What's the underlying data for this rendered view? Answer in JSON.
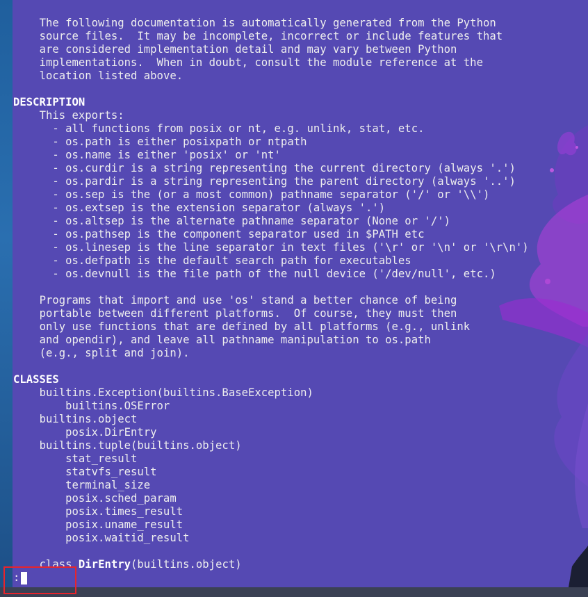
{
  "terminal": {
    "lines": [
      {
        "indent": "    ",
        "text": "The following documentation is automatically generated from the Python",
        "bold": false
      },
      {
        "indent": "    ",
        "text": "source files.  It may be incomplete, incorrect or include features that",
        "bold": false
      },
      {
        "indent": "    ",
        "text": "are considered implementation detail and may vary between Python",
        "bold": false
      },
      {
        "indent": "    ",
        "text": "implementations.  When in doubt, consult the module reference at the",
        "bold": false
      },
      {
        "indent": "    ",
        "text": "location listed above.",
        "bold": false
      },
      {
        "indent": "",
        "text": "",
        "bold": false
      },
      {
        "indent": "",
        "text": "DESCRIPTION",
        "bold": true
      },
      {
        "indent": "    ",
        "text": "This exports:",
        "bold": false
      },
      {
        "indent": "      ",
        "text": "- all functions from posix or nt, e.g. unlink, stat, etc.",
        "bold": false
      },
      {
        "indent": "      ",
        "text": "- os.path is either posixpath or ntpath",
        "bold": false
      },
      {
        "indent": "      ",
        "text": "- os.name is either 'posix' or 'nt'",
        "bold": false
      },
      {
        "indent": "      ",
        "text": "- os.curdir is a string representing the current directory (always '.')",
        "bold": false
      },
      {
        "indent": "      ",
        "text": "- os.pardir is a string representing the parent directory (always '..')",
        "bold": false
      },
      {
        "indent": "      ",
        "text": "- os.sep is the (or a most common) pathname separator ('/' or '\\\\')",
        "bold": false
      },
      {
        "indent": "      ",
        "text": "- os.extsep is the extension separator (always '.')",
        "bold": false
      },
      {
        "indent": "      ",
        "text": "- os.altsep is the alternate pathname separator (None or '/')",
        "bold": false
      },
      {
        "indent": "      ",
        "text": "- os.pathsep is the component separator used in $PATH etc",
        "bold": false
      },
      {
        "indent": "      ",
        "text": "- os.linesep is the line separator in text files ('\\r' or '\\n' or '\\r\\n')",
        "bold": false
      },
      {
        "indent": "      ",
        "text": "- os.defpath is the default search path for executables",
        "bold": false
      },
      {
        "indent": "      ",
        "text": "- os.devnull is the file path of the null device ('/dev/null', etc.)",
        "bold": false
      },
      {
        "indent": "",
        "text": "",
        "bold": false
      },
      {
        "indent": "    ",
        "text": "Programs that import and use 'os' stand a better chance of being",
        "bold": false
      },
      {
        "indent": "    ",
        "text": "portable between different platforms.  Of course, they must then",
        "bold": false
      },
      {
        "indent": "    ",
        "text": "only use functions that are defined by all platforms (e.g., unlink",
        "bold": false
      },
      {
        "indent": "    ",
        "text": "and opendir), and leave all pathname manipulation to os.path",
        "bold": false
      },
      {
        "indent": "    ",
        "text": "(e.g., split and join).",
        "bold": false
      },
      {
        "indent": "",
        "text": "",
        "bold": false
      },
      {
        "indent": "",
        "text": "CLASSES",
        "bold": true
      },
      {
        "indent": "    ",
        "text": "builtins.Exception(builtins.BaseException)",
        "bold": false
      },
      {
        "indent": "        ",
        "text": "builtins.OSError",
        "bold": false
      },
      {
        "indent": "    ",
        "text": "builtins.object",
        "bold": false
      },
      {
        "indent": "        ",
        "text": "posix.DirEntry",
        "bold": false
      },
      {
        "indent": "    ",
        "text": "builtins.tuple(builtins.object)",
        "bold": false
      },
      {
        "indent": "        ",
        "text": "stat_result",
        "bold": false
      },
      {
        "indent": "        ",
        "text": "statvfs_result",
        "bold": false
      },
      {
        "indent": "        ",
        "text": "terminal_size",
        "bold": false
      },
      {
        "indent": "        ",
        "text": "posix.sched_param",
        "bold": false
      },
      {
        "indent": "        ",
        "text": "posix.times_result",
        "bold": false
      },
      {
        "indent": "        ",
        "text": "posix.uname_result",
        "bold": false
      },
      {
        "indent": "        ",
        "text": "posix.waitid_result",
        "bold": false
      },
      {
        "indent": "",
        "text": "",
        "bold": false
      }
    ],
    "class_line": {
      "indent": "    ",
      "keyword": "class ",
      "name": "DirEntry",
      "rest": "(builtins.object)"
    },
    "prompt": ":"
  },
  "colors": {
    "terminal_bg": "#5549b3",
    "text": "#eeeeee",
    "highlight": "#e8242c",
    "splash_accent": "#a23bd6"
  }
}
